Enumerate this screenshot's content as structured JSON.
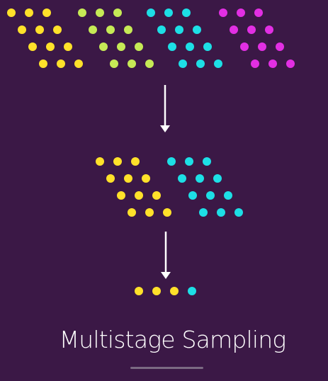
{
  "title": "Multistage Sampling",
  "colors": {
    "background": "#3b1846",
    "yellow": "#ffe12a",
    "green": "#c6ea56",
    "cyan": "#1ddfe6",
    "magenta": "#e22fe3",
    "arrow": "#ffffff"
  },
  "stage1": {
    "clusters": [
      {
        "name": "yellow",
        "color": "yellow",
        "points": 12
      },
      {
        "name": "green",
        "color": "green",
        "points": 12
      },
      {
        "name": "cyan",
        "color": "cyan",
        "points": 12
      },
      {
        "name": "magenta",
        "color": "magenta",
        "points": 12
      }
    ]
  },
  "stage2": {
    "clusters": [
      {
        "name": "yellow",
        "color": "yellow",
        "points": 12
      },
      {
        "name": "cyan",
        "color": "cyan",
        "points": 12
      }
    ]
  },
  "stage3": {
    "points": [
      "yellow",
      "yellow",
      "yellow",
      "cyan"
    ]
  }
}
